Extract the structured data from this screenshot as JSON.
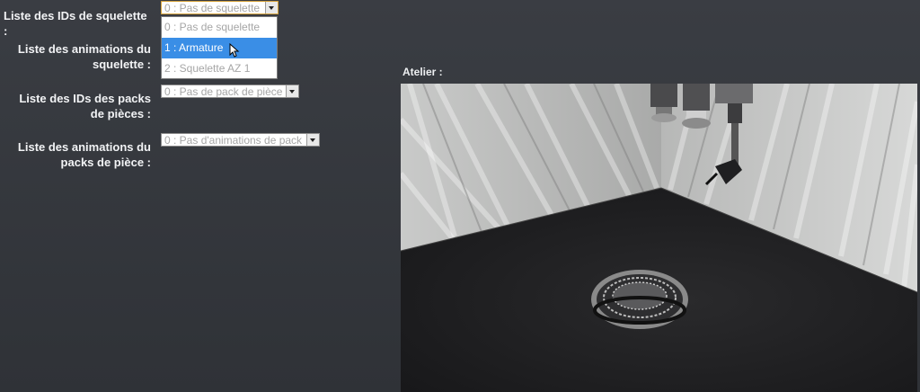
{
  "labels": {
    "skeleton_ids": "Liste des IDs de squelette :",
    "skeleton_animations": "Liste des animations du squelette :",
    "piece_pack_ids": "Liste des IDs des packs de pièces :",
    "piece_pack_animations": "Liste des animations du packs de pièce :"
  },
  "selects": {
    "skeleton_ids": {
      "value": "0 : Pas de squelette"
    },
    "piece_pack_ids": {
      "value": "0 : Pas de pack de pièce"
    },
    "piece_pack_animations": {
      "value": "0 : Pas d'animations de pack"
    }
  },
  "dropdown": {
    "options": [
      {
        "label": "0 : Pas de squelette",
        "selected": false
      },
      {
        "label": "1 : Armature",
        "selected": true
      },
      {
        "label": "2 : Squelette AZ 1",
        "selected": false
      }
    ]
  },
  "viewport": {
    "title": "Atelier :"
  }
}
